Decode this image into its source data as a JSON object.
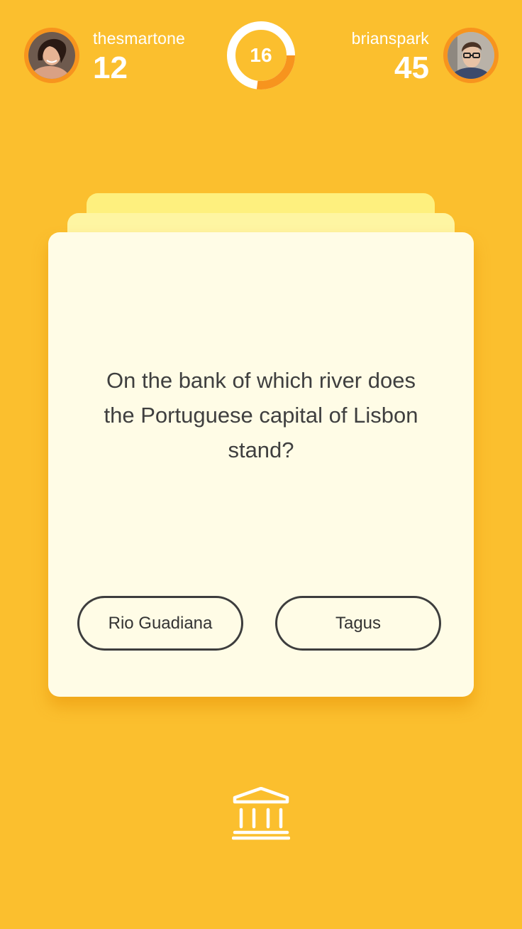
{
  "players": {
    "left": {
      "name": "thesmartone",
      "score": "12"
    },
    "right": {
      "name": "brianspark",
      "score": "45"
    }
  },
  "timer": {
    "value": "16",
    "remaining_fraction": 0.27
  },
  "card": {
    "question": "On the bank of which river does the Portuguese capital of Lisbon stand?",
    "answers": [
      "Rio Guadiana",
      "Tagus"
    ]
  },
  "category": {
    "icon": "museum-icon"
  },
  "colors": {
    "background": "#FBBF2E",
    "accent": "#F7941E",
    "card": "#FFFCE6",
    "text": "#3F3F3F"
  }
}
